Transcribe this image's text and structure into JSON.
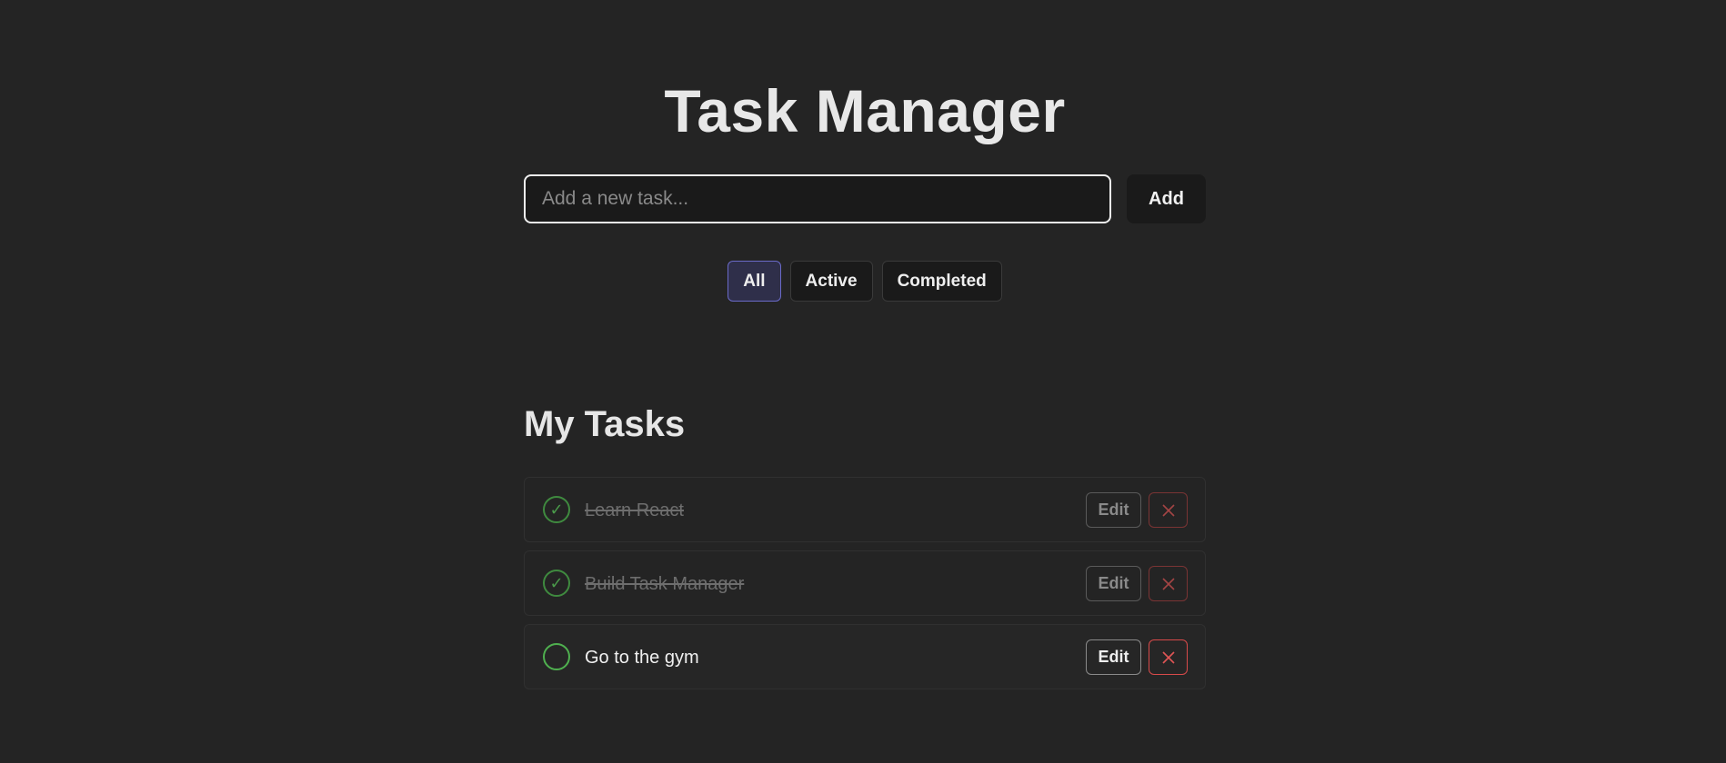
{
  "header": {
    "title": "Task Manager"
  },
  "new_task": {
    "placeholder": "Add a new task...",
    "value": "",
    "add_label": "Add"
  },
  "filters": [
    {
      "label": "All",
      "active": true
    },
    {
      "label": "Active",
      "active": false
    },
    {
      "label": "Completed",
      "active": false
    }
  ],
  "tasks_section": {
    "title": "My Tasks"
  },
  "tasks": [
    {
      "text": "Learn React",
      "completed": true,
      "edit_label": "Edit",
      "delete_icon": "close-icon"
    },
    {
      "text": "Build Task Manager",
      "completed": true,
      "edit_label": "Edit",
      "delete_icon": "close-icon"
    },
    {
      "text": "Go to the gym",
      "completed": false,
      "edit_label": "Edit",
      "delete_icon": "close-icon"
    }
  ],
  "colors": {
    "background": "#242424",
    "accent_active_filter": "#6a6ac8",
    "complete_green": "#4fb04f",
    "delete_red": "#e05555"
  }
}
